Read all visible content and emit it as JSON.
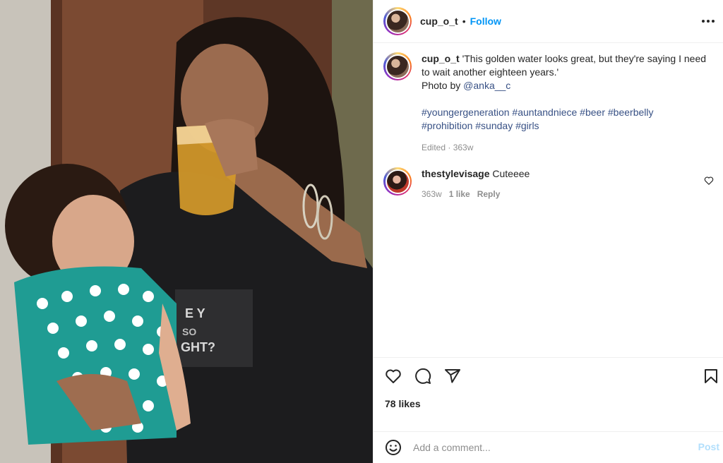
{
  "post": {
    "username": "cup_o_t",
    "separator": "•",
    "follow_label": "Follow",
    "more_icon": "more-horizontal-icon"
  },
  "caption": {
    "username": "cup_o_t",
    "text": "'This golden water looks great, but they're saying I need to wait another eighteen years.'",
    "photo_by": "Photo by",
    "mention": "@anka__c",
    "hashtags_line1": "#youngergeneration #auntandniece #beer #beerbelly",
    "hashtags_line2": "#prohibition #sunday #girls",
    "meta": "Edited · 363w"
  },
  "comments": [
    {
      "username": "thestylevisage",
      "text": "Cuteeee",
      "age": "363w",
      "likes": "1 like",
      "reply_label": "Reply"
    }
  ],
  "actions": {
    "like_icon": "heart-icon",
    "comment_icon": "comment-icon",
    "share_icon": "share-icon",
    "save_icon": "bookmark-icon",
    "likes": "78 likes"
  },
  "add_comment": {
    "placeholder": "Add a comment...",
    "post_label": "Post",
    "emoji_icon": "emoji-icon"
  },
  "colors": {
    "accent_blue": "#0095f6",
    "link_blue": "#385185",
    "muted": "#8e8e8e",
    "post_disabled": "#b2dffc"
  }
}
